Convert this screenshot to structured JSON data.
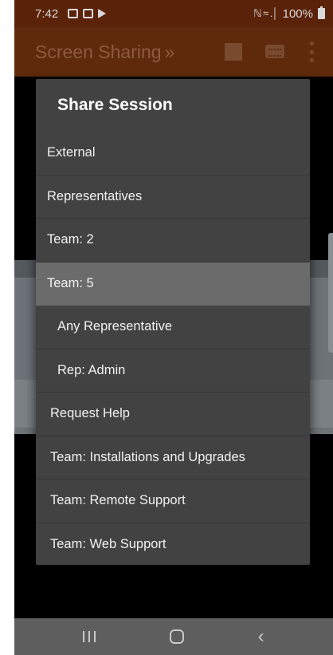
{
  "status_bar": {
    "time": "7:42",
    "signal_glyph": "ℕ ≈ .│",
    "battery_text": "100%"
  },
  "app_bar": {
    "title": "Screen Sharing",
    "title_suffix": "»",
    "icons": [
      "stop-icon",
      "keyboard-icon",
      "more-vert-icon"
    ],
    "color": "#5f2a0c"
  },
  "dialog": {
    "title": "Share Session",
    "items": [
      {
        "label": "External"
      },
      {
        "label": "Representatives"
      },
      {
        "label": "Team: 2"
      },
      {
        "label": "Team: 5",
        "selected": true
      },
      {
        "label": "Any Representative"
      },
      {
        "label": "Rep: Admin"
      },
      {
        "label": "Request Help"
      },
      {
        "label": "Team: Installations and Upgrades"
      },
      {
        "label": "Team: Remote Support"
      },
      {
        "label": "Team: Web Support"
      }
    ]
  },
  "nav_bar": {
    "icons": [
      "recent-apps-icon",
      "home-icon",
      "back-icon"
    ],
    "back_glyph": "‹"
  }
}
